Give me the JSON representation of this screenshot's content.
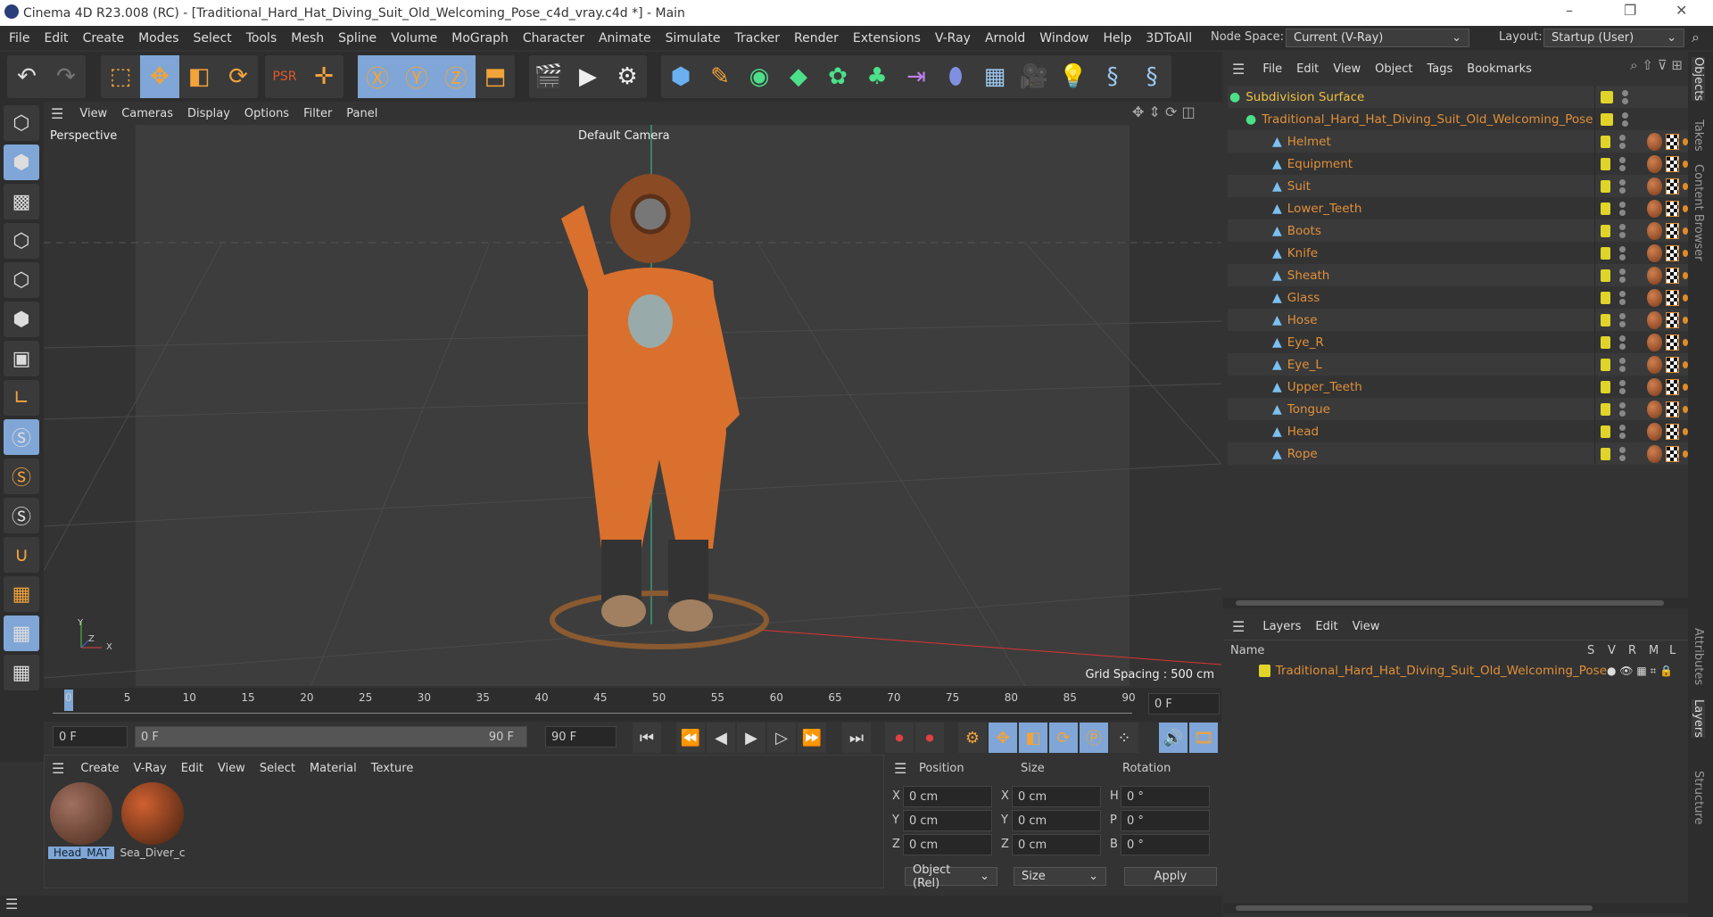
{
  "window": {
    "title": "Cinema 4D R23.008 (RC) - [Traditional_Hard_Hat_Diving_Suit_Old_Welcoming_Pose_c4d_vray.c4d *] - Main",
    "minimize": "–",
    "maximize": "❐",
    "close": "✕"
  },
  "menubar": {
    "items": [
      "File",
      "Edit",
      "Create",
      "Modes",
      "Select",
      "Tools",
      "Mesh",
      "Spline",
      "Volume",
      "MoGraph",
      "Character",
      "Animate",
      "Simulate",
      "Tracker",
      "Render",
      "Extensions",
      "V-Ray",
      "Arnold",
      "Window",
      "Help",
      "3DToAll"
    ],
    "node_space_label": "Node Space:",
    "node_space_value": "Current (V-Ray)",
    "layout_label": "Layout:",
    "layout_value": "Startup (User)"
  },
  "viewport": {
    "menu": [
      "View",
      "Cameras",
      "Display",
      "Options",
      "Filter",
      "Panel"
    ],
    "view_name": "Perspective",
    "camera": "Default Camera",
    "grid_spacing": "Grid Spacing : 500 cm",
    "axis": {
      "y": "Y",
      "z": "Z",
      "x": "X"
    }
  },
  "timeline": {
    "ticks": [
      "0",
      "5",
      "10",
      "15",
      "20",
      "25",
      "30",
      "35",
      "40",
      "45",
      "50",
      "55",
      "60",
      "65",
      "70",
      "75",
      "80",
      "85",
      "90"
    ],
    "current_frame": "0 F",
    "start": "0 F",
    "range_start": "0 F",
    "range_end": "90 F",
    "end": "90 F",
    "playhead_frame": 0
  },
  "materials": {
    "menu": [
      "Create",
      "V-Ray",
      "Edit",
      "View",
      "Select",
      "Material",
      "Texture"
    ],
    "items": [
      {
        "name": "Head_MAT",
        "selected": true
      },
      {
        "name": "Sea_Diver_c",
        "selected": false
      }
    ]
  },
  "coords": {
    "headers": [
      "Position",
      "Size",
      "Rotation"
    ],
    "rows": [
      {
        "pl": "X",
        "pv": "0 cm",
        "sl": "X",
        "sv": "0 cm",
        "rl": "H",
        "rv": "0 °"
      },
      {
        "pl": "Y",
        "pv": "0 cm",
        "sl": "Y",
        "sv": "0 cm",
        "rl": "P",
        "rv": "0 °"
      },
      {
        "pl": "Z",
        "pv": "0 cm",
        "sl": "Z",
        "sv": "0 cm",
        "rl": "B",
        "rv": "0 °"
      }
    ],
    "mode": "Object (Rel)",
    "size_mode": "Size",
    "apply": "Apply"
  },
  "objects": {
    "menu": [
      "File",
      "Edit",
      "View",
      "Object",
      "Tags",
      "Bookmarks"
    ],
    "root": "Subdivision Surface",
    "group": "Traditional_Hard_Hat_Diving_Suit_Old_Welcoming_Pose",
    "children": [
      "Helmet",
      "Equipment",
      "Suit",
      "Lower_Teeth",
      "Boots",
      "Knife",
      "Sheath",
      "Glass",
      "Hose",
      "Eye_R",
      "Eye_L",
      "Upper_Teeth",
      "Tongue",
      "Head",
      "Rope"
    ]
  },
  "layers": {
    "menu": [
      "Layers",
      "Edit",
      "View"
    ],
    "columns": [
      "Name",
      "S",
      "V",
      "R",
      "M",
      "L"
    ],
    "items": [
      "Traditional_Hard_Hat_Diving_Suit_Old_Welcoming_Pose"
    ]
  },
  "side_tabs": [
    "Objects",
    "Takes",
    "Content Browser",
    "Attributes",
    "Layers",
    "Structure"
  ],
  "colors": {
    "accent": "#7fa6d6",
    "object_name": "#e0903a",
    "root_name": "#f0c040",
    "layer_swatch": "#e0d42a"
  }
}
